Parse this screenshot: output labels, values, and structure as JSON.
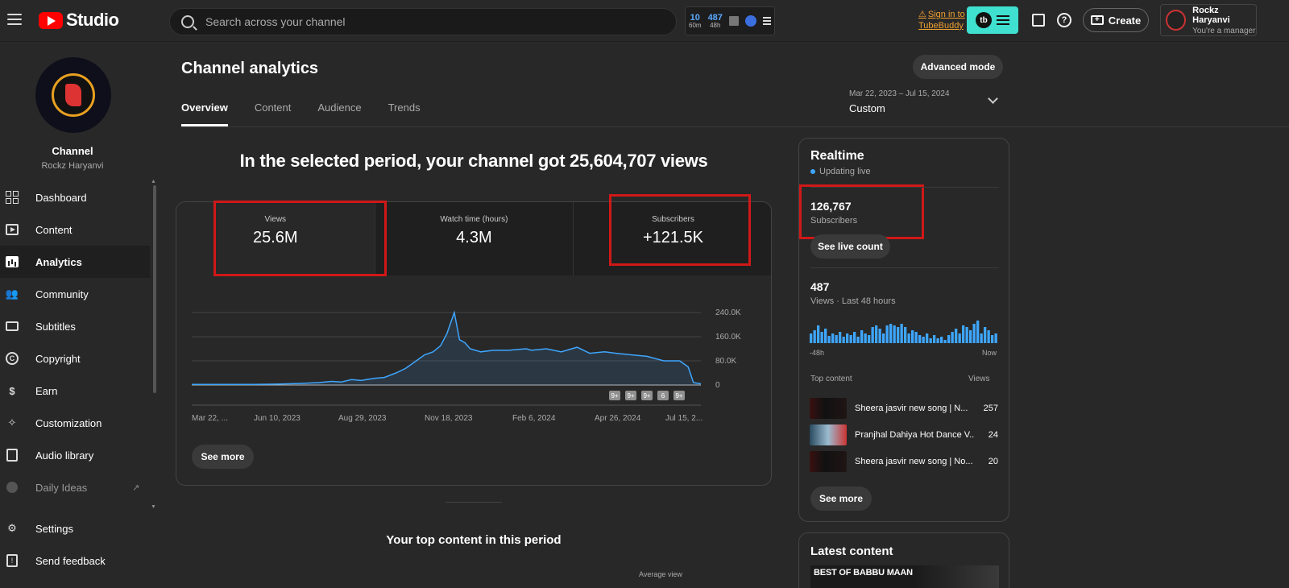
{
  "topbar": {
    "logo_text": "Studio",
    "search_placeholder": "Search across your channel",
    "ext_stat1_num": "10",
    "ext_stat1_lbl": "60m",
    "ext_stat2_num": "487",
    "ext_stat2_lbl": "48h",
    "tubebuddy_line1": "Sign in to",
    "tubebuddy_line2": "TubeBuddy",
    "tubebuddy_logo": "tb",
    "create_label": "Create",
    "account_name": "Rockz Haryanvi",
    "account_role": "You're a manager"
  },
  "sidebar": {
    "channel_label": "Channel",
    "channel_name": "Rockz Haryanvi",
    "items": [
      {
        "label": "Dashboard"
      },
      {
        "label": "Content"
      },
      {
        "label": "Analytics"
      },
      {
        "label": "Community"
      },
      {
        "label": "Subtitles"
      },
      {
        "label": "Copyright"
      },
      {
        "label": "Earn"
      },
      {
        "label": "Customization"
      },
      {
        "label": "Audio library"
      },
      {
        "label": "Daily Ideas"
      },
      {
        "label": "Settings"
      },
      {
        "label": "Send feedback"
      }
    ]
  },
  "main": {
    "title": "Channel analytics",
    "advanced_mode": "Advanced mode",
    "tabs": [
      {
        "label": "Overview"
      },
      {
        "label": "Content"
      },
      {
        "label": "Audience"
      },
      {
        "label": "Trends"
      }
    ],
    "date_range": "Mar 22, 2023 – Jul 15, 2024",
    "date_preset": "Custom",
    "headline": "In the selected period, your channel got 25,604,707 views",
    "metrics": [
      {
        "label": "Views",
        "value": "25.6M"
      },
      {
        "label": "Watch time (hours)",
        "value": "4.3M"
      },
      {
        "label": "Subscribers",
        "value": "+121.5K"
      }
    ],
    "see_more": "See more",
    "top_content_title": "Your top content in this period",
    "avg_view": "Average view"
  },
  "chart_data": {
    "type": "area",
    "x_ticks": [
      "Mar 22, ...",
      "Jun 10, 2023",
      "Aug 29, 2023",
      "Nov 18, 2023",
      "Feb 6, 2024",
      "Apr 26, 2024",
      "Jul 15, 2..."
    ],
    "y_ticks": [
      "240.0K",
      "160.0K",
      "80.0K",
      "0"
    ],
    "ylim": [
      0,
      240000
    ],
    "grid": true,
    "color": "#3ea6ff",
    "markers": [
      "9+",
      "9+",
      "9+",
      "6",
      "9+"
    ],
    "series": [
      {
        "x": [
          "2023-03-22",
          "2023-04-20",
          "2023-05-20",
          "2023-06-10",
          "2023-07-01",
          "2023-07-20",
          "2023-08-01",
          "2023-08-10",
          "2023-08-20",
          "2023-08-29",
          "2023-09-10",
          "2023-09-20",
          "2023-10-01",
          "2023-10-10",
          "2023-10-20",
          "2023-10-28",
          "2023-11-05",
          "2023-11-12",
          "2023-11-18",
          "2023-11-25",
          "2023-11-30",
          "2023-12-05",
          "2023-12-10",
          "2023-12-20",
          "2024-01-01",
          "2024-01-15",
          "2024-02-01",
          "2024-02-06",
          "2024-02-20",
          "2024-03-05",
          "2024-03-20",
          "2024-04-01",
          "2024-04-15",
          "2024-04-26",
          "2024-05-10",
          "2024-05-25",
          "2024-06-10",
          "2024-06-25",
          "2024-07-03",
          "2024-07-08",
          "2024-07-15"
        ],
        "values": [
          2000,
          2000,
          2000,
          3000,
          5000,
          8000,
          12000,
          10000,
          18000,
          15000,
          22000,
          25000,
          40000,
          55000,
          80000,
          100000,
          110000,
          130000,
          170000,
          240000,
          150000,
          140000,
          120000,
          110000,
          115000,
          115000,
          120000,
          115000,
          120000,
          110000,
          125000,
          105000,
          110000,
          105000,
          100000,
          95000,
          80000,
          80000,
          60000,
          8000,
          4000
        ]
      }
    ]
  },
  "realtime": {
    "title": "Realtime",
    "live_label": "Updating live",
    "subscribers_value": "126,767",
    "subscribers_label": "Subscribers",
    "see_live_count": "See live count",
    "views_value": "487",
    "views_label": "Views · Last 48 hours",
    "axis_left": "-48h",
    "axis_right": "Now",
    "bars": [
      12,
      16,
      22,
      14,
      18,
      9,
      12,
      10,
      14,
      8,
      12,
      10,
      14,
      8,
      16,
      12,
      10,
      20,
      22,
      18,
      12,
      22,
      24,
      22,
      20,
      24,
      20,
      12,
      16,
      14,
      10,
      8,
      12,
      6,
      10,
      6,
      8,
      4,
      10,
      14,
      18,
      12,
      22,
      20,
      16,
      24,
      28,
      12,
      20,
      16,
      10,
      12
    ],
    "top_content_label": "Top content",
    "top_views_label": "Views",
    "top_items": [
      {
        "title": "Sheera jasvir new song | N...",
        "views": "257"
      },
      {
        "title": "Pranjhal Dahiya Hot Dance V...",
        "views": "24"
      },
      {
        "title": "Sheera jasvir new song | No...",
        "views": "20"
      }
    ],
    "see_more": "See more"
  },
  "latest": {
    "title": "Latest content",
    "thumb_text": "BEST OF BABBU MAAN"
  }
}
